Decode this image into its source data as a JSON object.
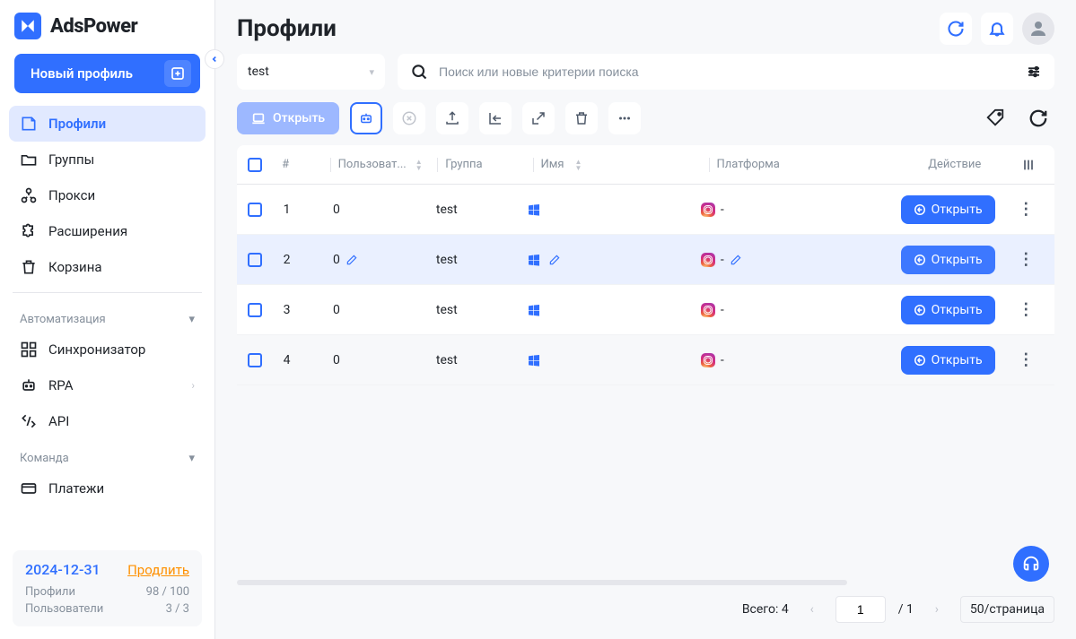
{
  "brand": "AdsPower",
  "sidebar": {
    "new_profile_label": "Новый профиль",
    "nav": [
      {
        "label": "Профили"
      },
      {
        "label": "Группы"
      },
      {
        "label": "Прокси"
      },
      {
        "label": "Расширения"
      },
      {
        "label": "Корзина"
      }
    ],
    "sections": {
      "automation": "Автоматизация",
      "team": "Команда"
    },
    "automation_items": [
      {
        "label": "Синхронизатор"
      },
      {
        "label": "RPA"
      },
      {
        "label": "API"
      }
    ],
    "team_items": [
      {
        "label": "Платежи"
      }
    ],
    "license": {
      "date": "2024-12-31",
      "renew": "Продлить",
      "profiles_label": "Профили",
      "profiles_value": "98 / 100",
      "users_label": "Пользователи",
      "users_value": "3 / 3"
    }
  },
  "header": {
    "title": "Профили"
  },
  "search": {
    "group_value": "test",
    "placeholder": "Поиск или новые критерии поиска"
  },
  "toolbar": {
    "open_label": "Открыть"
  },
  "table": {
    "columns": {
      "num": "#",
      "user": "Пользоват...",
      "group": "Группа",
      "name": "Имя",
      "platform": "Платформа",
      "action": "Действие"
    },
    "open_label": "Открыть",
    "rows": [
      {
        "num": "1",
        "user": "0",
        "group": "test",
        "platform_text": "-"
      },
      {
        "num": "2",
        "user": "0",
        "group": "test",
        "platform_text": "-"
      },
      {
        "num": "3",
        "user": "0",
        "group": "test",
        "platform_text": "-"
      },
      {
        "num": "4",
        "user": "0",
        "group": "test",
        "platform_text": "-"
      }
    ]
  },
  "footer": {
    "total_label": "Всего: 4",
    "page_value": "1",
    "page_total": "/ 1",
    "page_size": "50/страница"
  }
}
